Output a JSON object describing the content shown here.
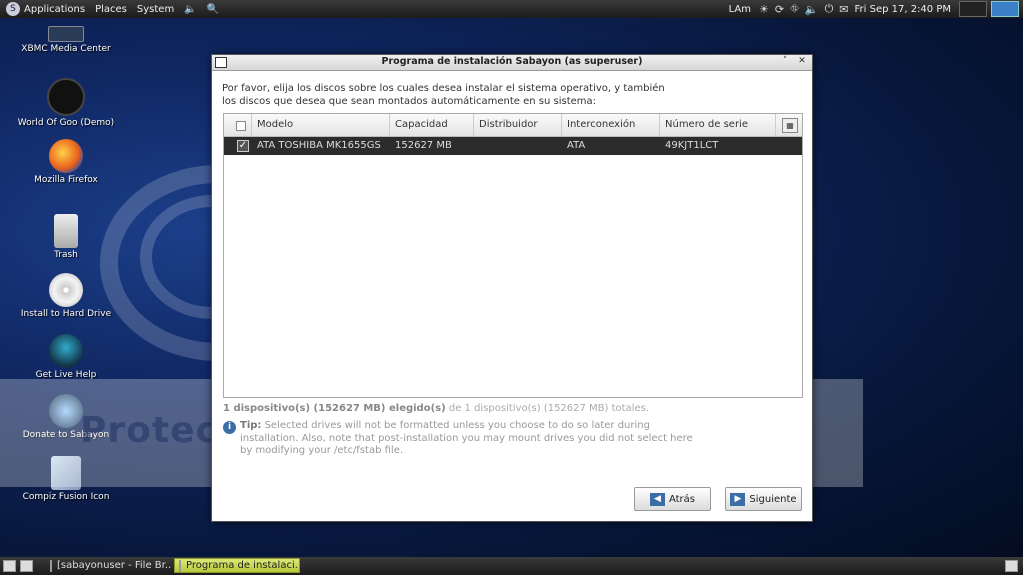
{
  "top_panel": {
    "menus": [
      "Applications",
      "Places",
      "System"
    ],
    "keyboard": "LAm",
    "clock": "Fri Sep 17,  2:40 PM"
  },
  "desktop_icons": [
    {
      "label": "XBMC Media Center",
      "icon": "xbmc-icon"
    },
    {
      "label": "World Of Goo (Demo)",
      "icon": "goo-icon"
    },
    {
      "label": "Mozilla Firefox",
      "icon": "firefox-icon"
    },
    {
      "label": "Trash",
      "icon": "trash-icon"
    },
    {
      "label": "Install to Hard Drive",
      "icon": "disc-icon"
    },
    {
      "label": "Get Live Help",
      "icon": "help-icon"
    },
    {
      "label": "Donate to Sabayon",
      "icon": "donate-icon"
    },
    {
      "label": "Compiz Fusion Icon",
      "icon": "compiz-icon"
    }
  ],
  "watermark": "Protect m",
  "dialog": {
    "title": "Programa de instalación Sabayon (as superuser)",
    "intro": "Por favor, elija los discos sobre los cuales desea instalar el sistema operativo, y también los discos que desea que sean montados automáticamente en su sistema:",
    "columns": [
      "Modelo",
      "Capacidad",
      "Distribuidor",
      "Interconexión",
      "Número de serie"
    ],
    "rows": [
      {
        "checked": true,
        "model": "ATA TOSHIBA MK1655GS",
        "capacity": "152627 MB",
        "vendor": "",
        "interconnect": "ATA",
        "serial": "49KJT1LCT"
      }
    ],
    "summary_bold": "1 dispositivo(s) (152627 MB) elegido(s)",
    "summary_rest": " de 1 dispositivo(s) (152627 MB) totales.",
    "tip_label": "Tip:",
    "tip_text": " Selected drives will not be formatted unless you choose to do so later during installation.  Also, note that post-installation you may mount drives you did not select here by modifying your /etc/fstab file.",
    "back_label": "Atrás",
    "next_label": "Siguiente"
  },
  "taskbar": {
    "tasks": [
      "[sabayonuser - File Br...",
      "Programa de instalaci..."
    ],
    "active_index": 1
  }
}
